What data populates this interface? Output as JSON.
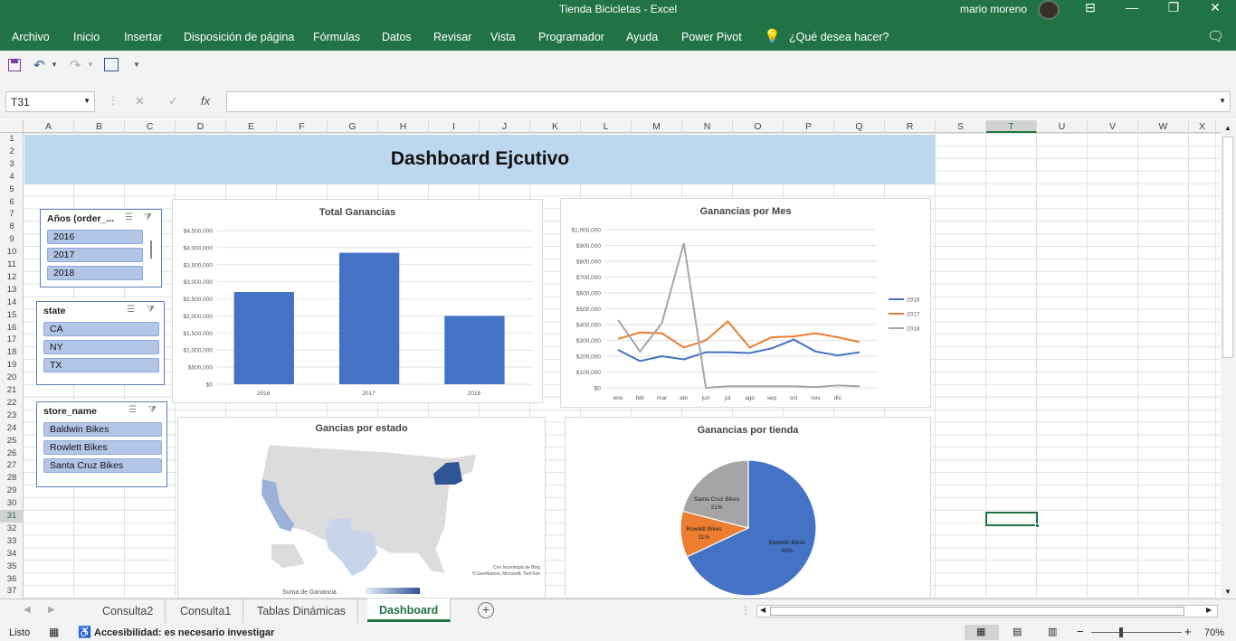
{
  "window": {
    "title": "Tienda Bicicletas  -  Excel",
    "user": "mario moreno"
  },
  "ribbon": {
    "tabs": [
      "Archivo",
      "Inicio",
      "Insertar",
      "Disposición de página",
      "Fórmulas",
      "Datos",
      "Revisar",
      "Vista",
      "Programador",
      "Ayuda",
      "Power Pivot"
    ],
    "tell_me": "¿Qué desea hacer?"
  },
  "formula_bar": {
    "name_box": "T31",
    "fx_label": "fx",
    "formula": ""
  },
  "columns": [
    "A",
    "B",
    "C",
    "D",
    "E",
    "F",
    "G",
    "H",
    "I",
    "J",
    "K",
    "L",
    "M",
    "N",
    "O",
    "P",
    "Q",
    "R",
    "S",
    "T",
    "U",
    "V",
    "W",
    "X"
  ],
  "rows": [
    "1",
    "2",
    "3",
    "4",
    "5",
    "6",
    "7",
    "8",
    "9",
    "10",
    "11",
    "12",
    "13",
    "14",
    "15",
    "16",
    "17",
    "18",
    "19",
    "20",
    "21",
    "22",
    "23",
    "24",
    "25",
    "26",
    "27",
    "28",
    "29",
    "30",
    "31",
    "32",
    "33",
    "34",
    "35",
    "36",
    "37"
  ],
  "dashboard": {
    "title": "Dashboard Ejcutivo"
  },
  "slicers": {
    "years": {
      "header": "Años (order_...",
      "items": [
        "2016",
        "2017",
        "2018"
      ]
    },
    "state": {
      "header": "state",
      "items": [
        "CA",
        "NY",
        "TX"
      ]
    },
    "store": {
      "header": "store_name",
      "items": [
        "Baldwin Bikes",
        "Rowlett Bikes",
        "Santa Cruz Bikes"
      ]
    }
  },
  "charts": {
    "map": {
      "title": "Gancias por estado",
      "legend_label": "Suma de Ganancia",
      "credit1": "Con tecnología de Bing",
      "credit2": "© GeoNames, Microsoft, TomTom",
      "colors": {
        "NY": "#2f5597",
        "CA": "#9bb1d8",
        "TX": "#c7d5ec",
        "other": "#dcdcdc"
      }
    }
  },
  "chart_data": [
    {
      "type": "bar",
      "title": "Total Ganancias",
      "categories": [
        "2016",
        "2017",
        "2018"
      ],
      "values": [
        2700000,
        3850000,
        2000000
      ],
      "ylim": [
        0,
        4500000
      ],
      "yticks": [
        "$0",
        "$500,000",
        "$1,000,000",
        "$1,500,000",
        "$2,000,000",
        "$2,500,000",
        "$3,000,000",
        "$3,500,000",
        "$4,000,000",
        "$4,500,000"
      ],
      "color": "#4472c4",
      "grid": true
    },
    {
      "type": "line",
      "title": "Ganancias por Mes",
      "categories": [
        "ene",
        "feb",
        "mar",
        "abr",
        "jun",
        "jul",
        "ago",
        "sep",
        "oct",
        "nov",
        "dic"
      ],
      "ylim": [
        0,
        1000000
      ],
      "yticks": [
        "$0",
        "$100,000",
        "$200,000",
        "$300,000",
        "$400,000",
        "$500,000",
        "$600,000",
        "$700,000",
        "$800,000",
        "$900,000",
        "$1,000,000"
      ],
      "series": [
        {
          "name": "2016",
          "color": "#4472c4",
          "values": [
            240000,
            170000,
            200000,
            180000,
            225000,
            225000,
            220000,
            250000,
            305000,
            230000,
            205000,
            225000
          ]
        },
        {
          "name": "2017",
          "color": "#ed7d31",
          "values": [
            310000,
            350000,
            345000,
            255000,
            300000,
            420000,
            255000,
            320000,
            325000,
            345000,
            320000,
            290000
          ]
        },
        {
          "name": "2018",
          "color": "#a5a5a5",
          "values": [
            430000,
            230000,
            410000,
            915000,
            0,
            10000,
            10000,
            10000,
            10000,
            5000,
            15000,
            10000
          ]
        }
      ],
      "legend": "right",
      "grid": true
    },
    {
      "type": "pie",
      "title": "Ganancias por tienda",
      "slices": [
        {
          "label": "Baldwin Bikes",
          "pct_label": "68%",
          "value": 68,
          "color": "#4472c4"
        },
        {
          "label": "Rowlett Bikes",
          "pct_label": "11%",
          "value": 11,
          "color": "#ed7d31"
        },
        {
          "label": "Santa Cruz Bikes",
          "pct_label": "21%",
          "value": 21,
          "color": "#a5a5a5"
        }
      ]
    }
  ],
  "sheets": [
    "Consulta2",
    "Consulta1",
    "Tablas Dinámicas",
    "Dashboard"
  ],
  "active_sheet": "Dashboard",
  "status": {
    "ready": "Listo",
    "accessibility": "Accesibilidad: es necesario investigar",
    "zoom": "70%"
  }
}
